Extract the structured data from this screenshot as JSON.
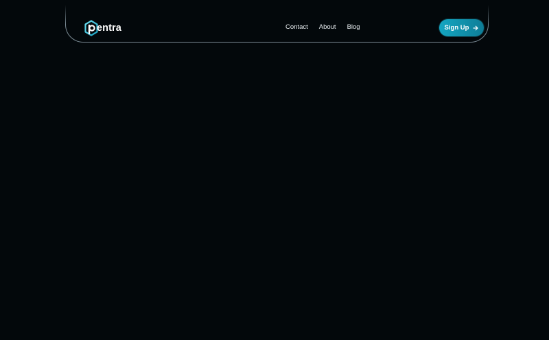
{
  "brand": {
    "name": "entra",
    "accent": "#14a6c2"
  },
  "nav": {
    "links": [
      {
        "label": "Contact"
      },
      {
        "label": "About"
      },
      {
        "label": "Blog"
      }
    ]
  },
  "cta": {
    "label": "Sign Up",
    "icon": "arrow-right-icon"
  },
  "colors": {
    "background": "#03080b",
    "button": "#14a6c2"
  }
}
